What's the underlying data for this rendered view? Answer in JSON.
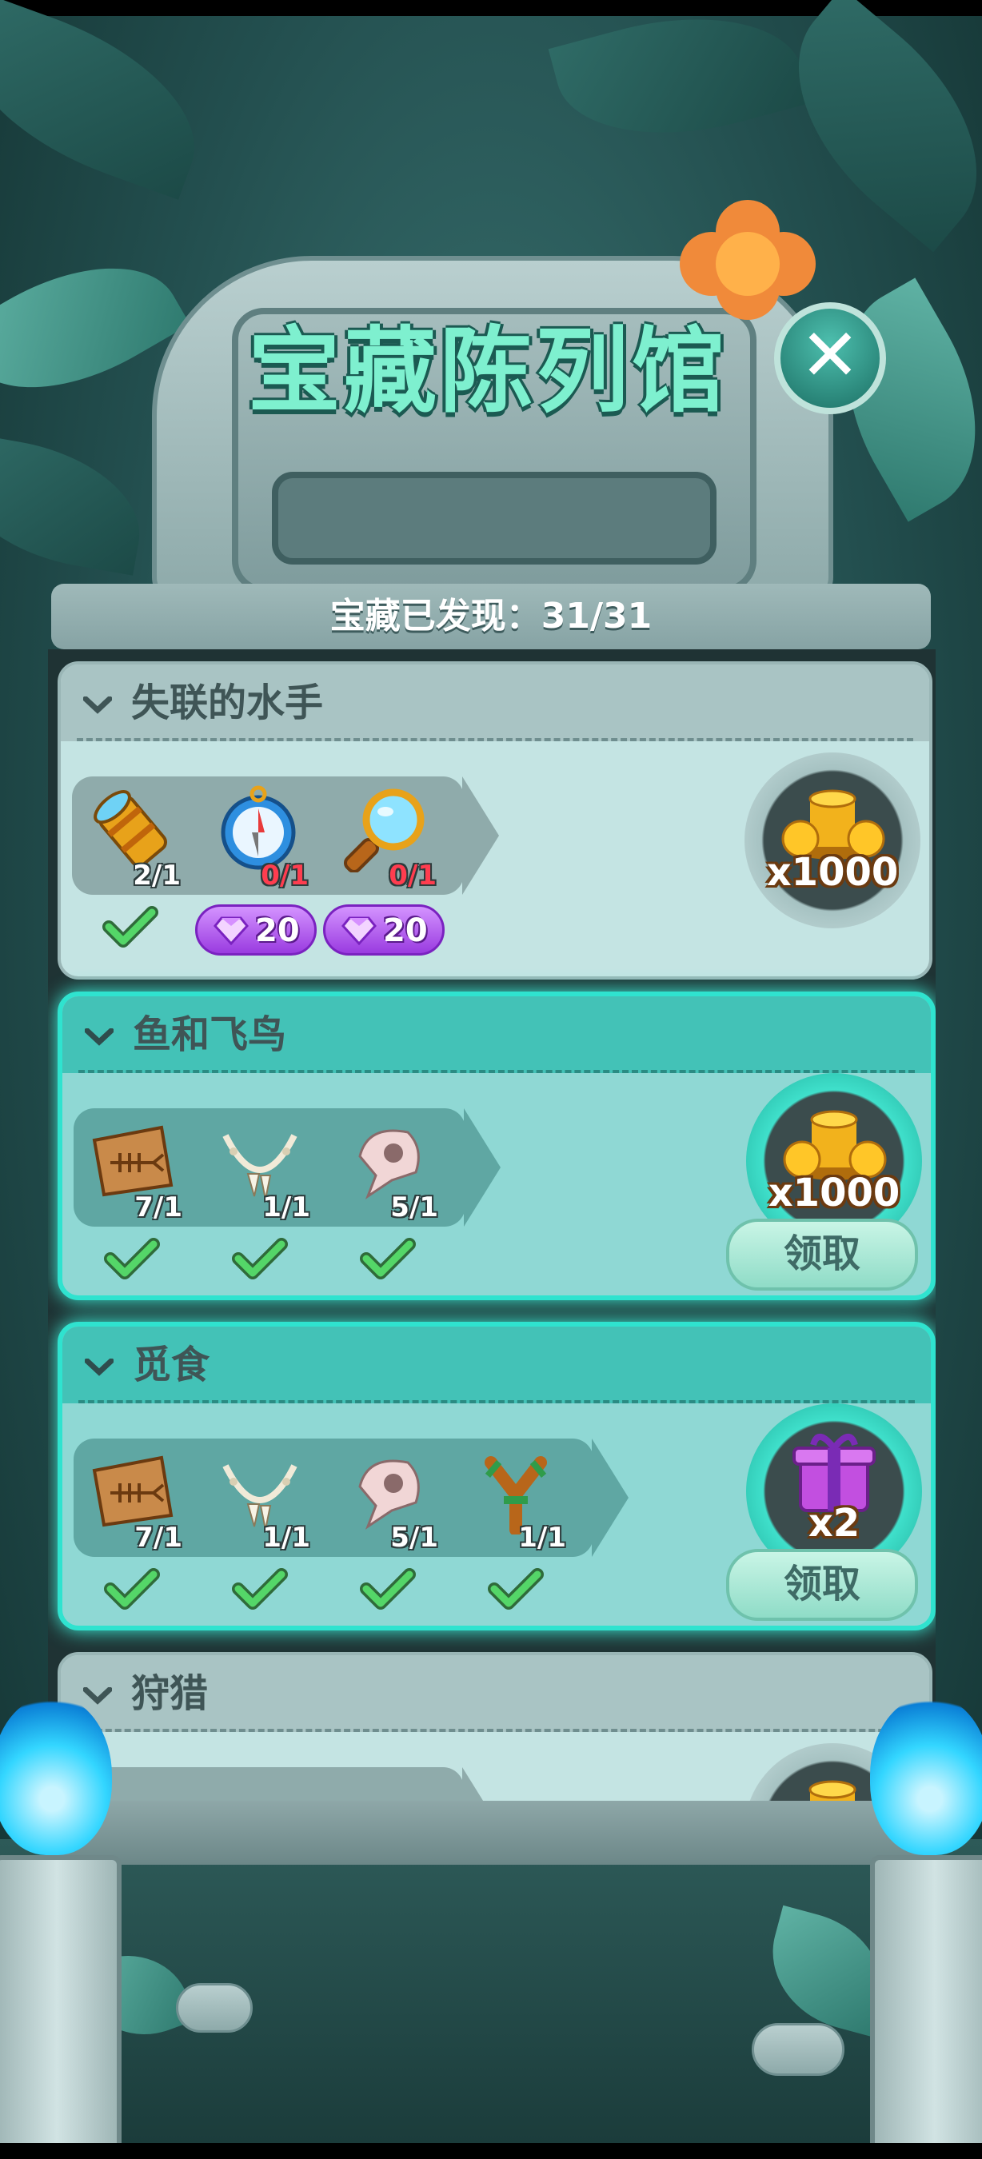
{
  "title": "宝藏陈列馆",
  "close_label": "✕",
  "discovered": {
    "label": "宝藏已发现：",
    "value": "31/31"
  },
  "sets": [
    {
      "name": "失联的水手",
      "state": "incomplete",
      "items": [
        {
          "icon": "spyglass-icon",
          "count": "2/1",
          "owned": true
        },
        {
          "icon": "compass-icon",
          "count": "0/1",
          "owned": false,
          "cost": "20"
        },
        {
          "icon": "magnifier-icon",
          "count": "0/1",
          "owned": false,
          "cost": "20"
        }
      ],
      "reward": {
        "icon": "gold-coins-icon",
        "amount": "x1000"
      }
    },
    {
      "name": "鱼和飞鸟",
      "state": "claimable",
      "items": [
        {
          "icon": "fish-fossil-icon",
          "count": "7/1",
          "owned": true
        },
        {
          "icon": "bone-necklace-icon",
          "count": "1/1",
          "owned": true
        },
        {
          "icon": "bird-skull-icon",
          "count": "5/1",
          "owned": true
        }
      ],
      "reward": {
        "icon": "gold-coins-icon",
        "amount": "x1000"
      },
      "claim_label": "领取"
    },
    {
      "name": "觅食",
      "state": "claimable",
      "items": [
        {
          "icon": "fish-fossil-icon",
          "count": "7/1",
          "owned": true
        },
        {
          "icon": "bone-necklace-icon",
          "count": "1/1",
          "owned": true
        },
        {
          "icon": "bird-skull-icon",
          "count": "5/1",
          "owned": true
        },
        {
          "icon": "slingshot-icon",
          "count": "1/1",
          "owned": true
        }
      ],
      "reward": {
        "icon": "gift-box-icon",
        "amount": "x2"
      },
      "claim_label": "领取"
    },
    {
      "name": "狩猎",
      "state": "partially-visible",
      "reward": {
        "icon": "gold-coins-icon"
      }
    }
  ],
  "colors": {
    "accent": "#2fe3cf",
    "gem": "#b45cf0",
    "title": "#7ef0cf"
  }
}
